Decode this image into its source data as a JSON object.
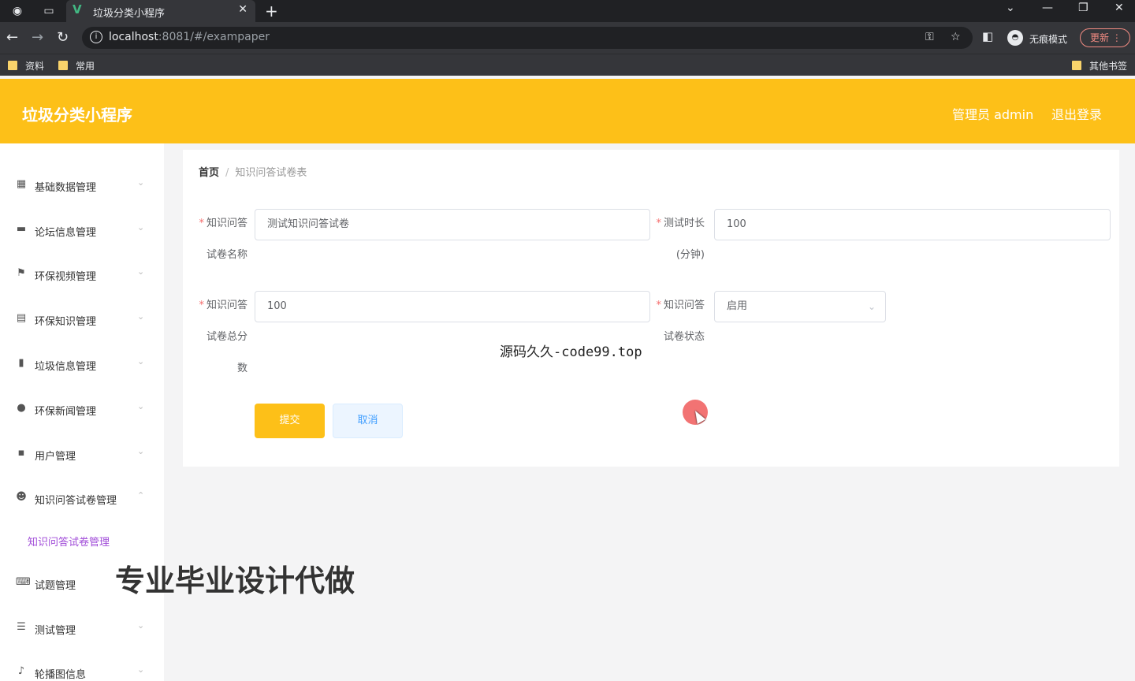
{
  "browser": {
    "tab_title": "垃圾分类小程序",
    "tab_logo": "V",
    "url_host": "localhost",
    "url_rest": ":8081/#/exampaper",
    "incognito_label": "无痕模式",
    "update_label": "更新",
    "bookmarks": [
      "资料",
      "常用"
    ],
    "other_bookmarks": "其他书签"
  },
  "header": {
    "title": "垃圾分类小程序",
    "user": "管理员 admin",
    "logout": "退出登录"
  },
  "sidebar": {
    "items": [
      {
        "label": "基础数据管理",
        "icon": "grid-icon"
      },
      {
        "label": "论坛信息管理",
        "icon": "monitor-icon"
      },
      {
        "label": "环保视频管理",
        "icon": "flag-icon"
      },
      {
        "label": "环保知识管理",
        "icon": "document-icon"
      },
      {
        "label": "垃圾信息管理",
        "icon": "bar-chart-icon"
      },
      {
        "label": "环保新闻管理",
        "icon": "bulb-icon"
      },
      {
        "label": "用户管理",
        "icon": "chat-icon"
      },
      {
        "label": "知识问答试卷管理",
        "icon": "user-icon"
      },
      {
        "label": "试题管理",
        "icon": "keyboard-icon"
      },
      {
        "label": "测试管理",
        "icon": "list-icon"
      },
      {
        "label": "轮播图信息",
        "icon": "mic-icon"
      }
    ],
    "active_sub": "知识问答试卷管理"
  },
  "breadcrumb": {
    "home": "首页",
    "separator": "/",
    "current": "知识问答试卷表"
  },
  "form": {
    "name_label_1": "知识问答",
    "name_label_2": "试卷名称",
    "name_value": "测试知识问答试卷",
    "duration_label_1": "测试时长",
    "duration_label_2": "(分钟)",
    "duration_value": "100",
    "score_label_1": "知识问答",
    "score_label_2": "试卷总分",
    "score_label_3": "数",
    "score_value": "100",
    "status_label_1": "知识问答",
    "status_label_2": "试卷状态",
    "status_value": "启用",
    "submit": "提交",
    "cancel": "取消"
  },
  "overlays": {
    "mid_text": "源码久久-code99.top",
    "big_text": "专业毕业设计代做"
  },
  "colors": {
    "brand": "#fdc018",
    "active_sub": "#a04bd8",
    "required": "#f56c6c"
  }
}
